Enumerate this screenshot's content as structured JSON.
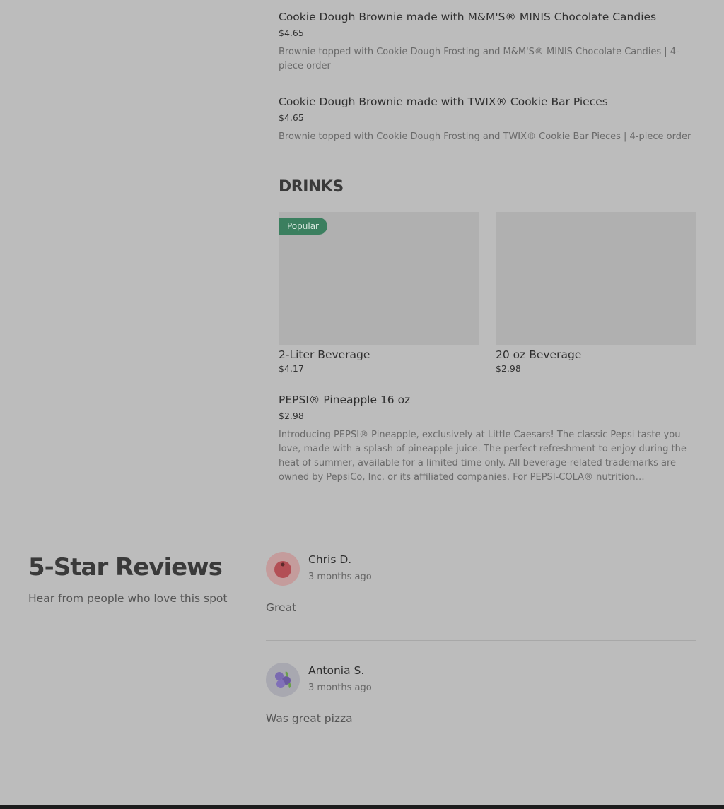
{
  "menu_items_top": [
    {
      "title": "Cookie Dough Brownie made with M&M'S® MINIS Chocolate Candies",
      "price": "$4.65",
      "description": "Brownie topped with Cookie Dough Frosting and M&M'S® MINIS Chocolate Candies | 4-piece order"
    },
    {
      "title": "Cookie Dough Brownie made with TWIX® Cookie Bar Pieces",
      "price": "$4.65",
      "description": "Brownie topped with Cookie Dough Frosting and TWIX® Cookie Bar Pieces | 4-piece order"
    }
  ],
  "drinks": {
    "section_title": "DRINKS",
    "cards": [
      {
        "badge": "Popular",
        "title": "2-Liter Beverage",
        "price": "$4.17"
      },
      {
        "title": "20 oz Beverage",
        "price": "$2.98"
      }
    ],
    "item": {
      "title": "PEPSI® Pineapple 16 oz",
      "price": "$2.98",
      "description": "Introducing PEPSI® Pineapple, exclusively at Little Caesars! The classic Pepsi taste you love, made with a splash of pineapple juice. The perfect refreshment to enjoy during the heat of summer, available for a limited time only. All beverage-related trademarks are owned by PepsiCo, Inc. or its affiliated companies. For PEPSI-COLA® nutrition information, visit pepsico.com."
    }
  },
  "reviews": {
    "title": "5-Star Reviews",
    "subtitle": "Hear from people who love this spot",
    "items": [
      {
        "name": "Chris D.",
        "date": "3 months ago",
        "text": "Great",
        "avatar_icon": "cherry-avatar-icon"
      },
      {
        "name": "Antonia S.",
        "date": "3 months ago",
        "text": "Was great pizza",
        "avatar_icon": "blueberry-avatar-icon"
      }
    ]
  },
  "colors": {
    "background": "#bcbcbc",
    "badge": "#3b7f5f",
    "image_placeholder": "#b0b0b0"
  }
}
